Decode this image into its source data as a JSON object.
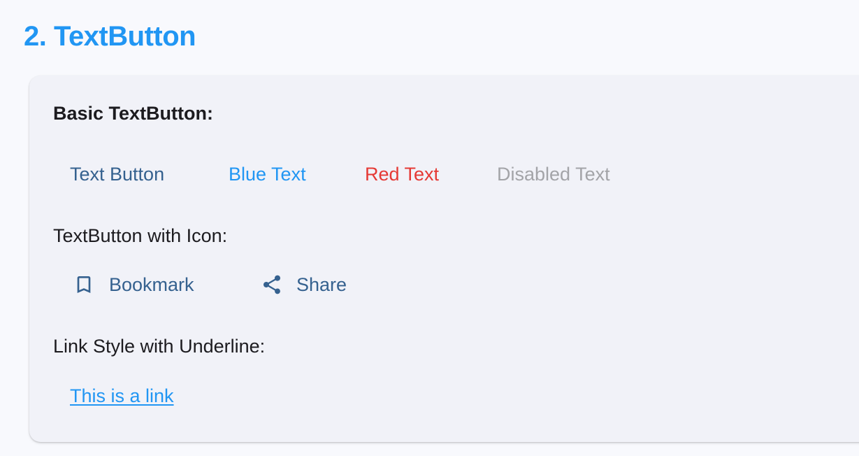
{
  "section": {
    "title": "2. TextButton"
  },
  "card": {
    "basic_label": "Basic TextButton:",
    "basic_buttons": [
      {
        "label": "Text Button",
        "color": "#35618f"
      },
      {
        "label": "Blue Text",
        "color": "#2196f3"
      },
      {
        "label": "Red Text",
        "color": "#e53935"
      },
      {
        "label": "Disabled Text",
        "color": "#a3a4a8",
        "disabled": true
      }
    ],
    "icon_label": "TextButton with Icon:",
    "icon_buttons": [
      {
        "label": "Bookmark",
        "icon": "bookmark-icon"
      },
      {
        "label": "Share",
        "icon": "share-icon"
      }
    ],
    "link_label": "Link Style with Underline:",
    "link_text": "This is a link"
  },
  "colors": {
    "accent": "#2196f3",
    "primary_text_button": "#35618f",
    "danger": "#e53935",
    "disabled": "#a3a4a8",
    "card_background": "#f1f2f8",
    "page_background": "#f8f9fd"
  }
}
